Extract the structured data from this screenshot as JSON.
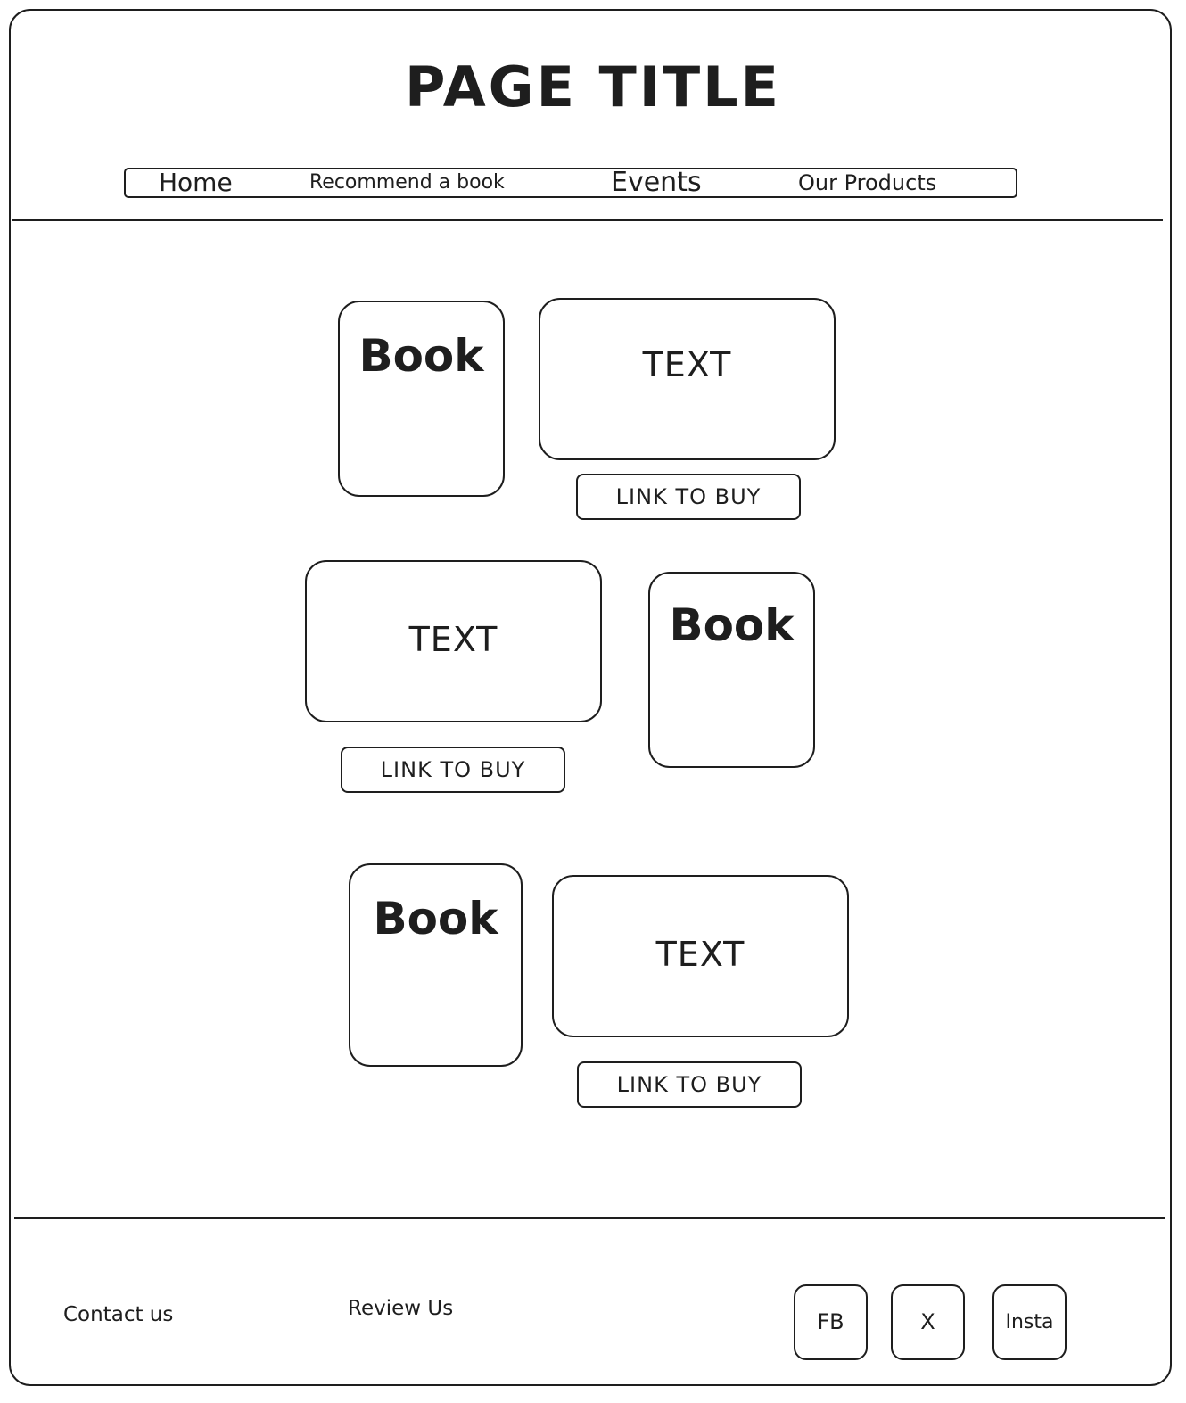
{
  "header": {
    "title": "PAGE TITLE"
  },
  "nav": {
    "items": [
      {
        "label": "Home"
      },
      {
        "label": "Recommend a book"
      },
      {
        "label": "Events"
      },
      {
        "label": "Our Products"
      }
    ]
  },
  "main": {
    "rows": [
      {
        "book_label": "Book",
        "text_label": "TEXT",
        "buy_label": "LINK TO BUY"
      },
      {
        "book_label": "Book",
        "text_label": "TEXT",
        "buy_label": "LINK TO BUY"
      },
      {
        "book_label": "Book",
        "text_label": "TEXT",
        "buy_label": "LINK TO BUY"
      }
    ]
  },
  "footer": {
    "contact_label": "Contact us",
    "review_label": "Review Us",
    "social": [
      {
        "label": "FB"
      },
      {
        "label": "X"
      },
      {
        "label": "Insta"
      }
    ]
  }
}
